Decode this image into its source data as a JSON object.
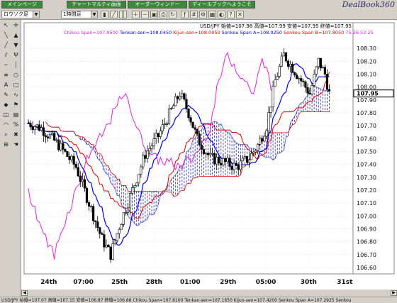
{
  "tabs": [
    "メインページ",
    "チャートマルティ画面",
    "オーダーウィンドー",
    "ディールブックへようこそ"
  ],
  "brand": "DealBook360",
  "toolbar": {
    "symbol": "ロウソク足",
    "timeframe": "1時間足"
  },
  "tool_icons": [
    "cursor-icon",
    "crosshair-icon",
    "line-icon",
    "arrow-up-icon",
    "trendline-icon",
    "arrow-down-icon",
    "channel-icon",
    "pitchfork-icon",
    "hline-icon",
    "vline-icon",
    "fib-icon",
    "ellipse-icon",
    "text-icon",
    "rect-icon",
    "pen-icon",
    "draw-icon",
    "color-icon",
    "flag-icon",
    "label-icon",
    "note-icon",
    "cycle-icon",
    "percent-icon",
    "zoom-icon",
    "delete-icon",
    "grid-icon",
    "hand-icon"
  ],
  "header": {
    "ohlc": "USD/JPY 始値=107.98 高値=107.99 安値=107.95 終値=107.95",
    "chikou": "Chikou Span=107.9500",
    "tenkan": "Tenkan-sen=108.0450",
    "kijun": "Kijun-sen=108.0050",
    "spanA": "Senkou Span A=108.0250",
    "spanB": "Senkou Span B=107.8050",
    "extra": "75.26,52.25"
  },
  "status": "USD/JPY 始値=107.07 高値=107.15 安値=106.87 終値=106.88 Chikou Span=107.8100 Tenkan-sen=107.1650 Kijun-sen=107.4200 Senkou Span A=107.2925 Senkou",
  "colors": {
    "candle_up": "#ffffff",
    "candle_down": "#000000",
    "tenkan": "#0000dd",
    "kijun": "#dd0000",
    "chikou": "#dd22dd",
    "cloud": "#2222aa",
    "price_box": "#ffffff"
  },
  "chart_data": {
    "type": "candlestick",
    "symbol": "USD/JPY",
    "ylim": [
      106.55,
      108.4
    ],
    "yticks": [
      106.6,
      106.7,
      106.8,
      106.9,
      107.0,
      107.1,
      107.2,
      107.3,
      107.4,
      107.5,
      107.6,
      107.7,
      107.8,
      107.9,
      108.0,
      108.1,
      108.2,
      108.3
    ],
    "last_price": 107.95,
    "xticks": [
      "24th",
      "07:00",
      "25th",
      "28th",
      "01:00",
      "29th",
      "05:00",
      "30th",
      "31st"
    ],
    "series": [
      {
        "name": "Chikou Span"
      },
      {
        "name": "Tenkan-sen"
      },
      {
        "name": "Kijun-sen"
      },
      {
        "name": "Senkou Span A"
      },
      {
        "name": "Senkou Span B"
      }
    ]
  }
}
